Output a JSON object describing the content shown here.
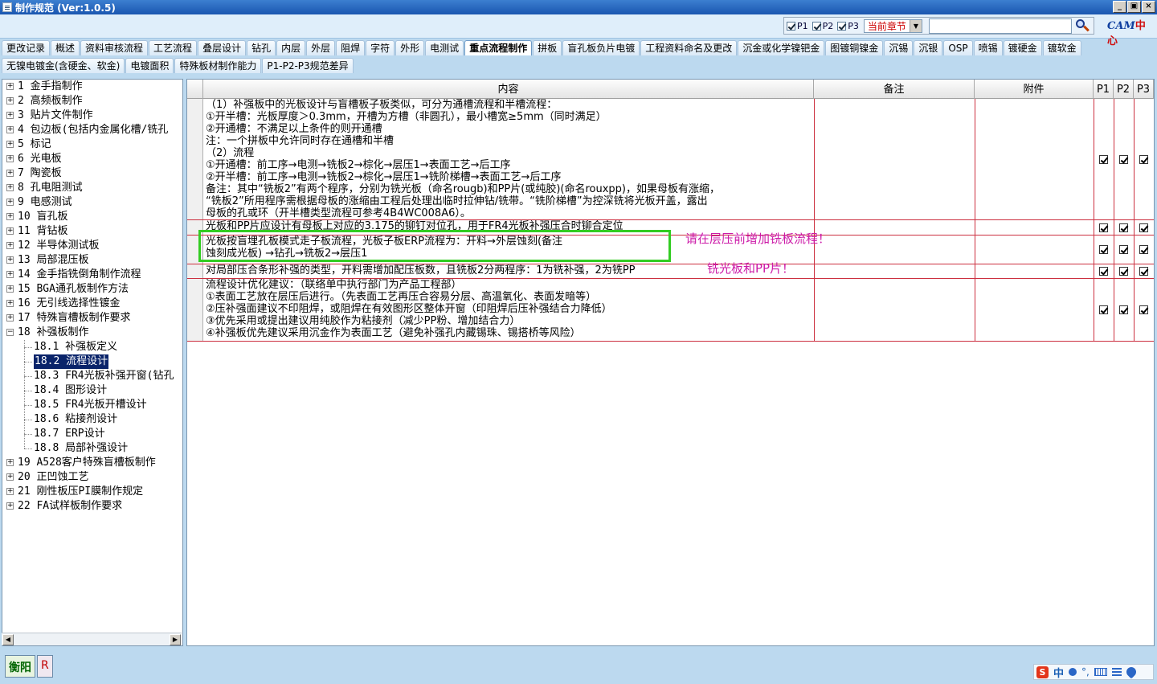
{
  "window": {
    "title": "制作规范 (Ver:1.0.5)",
    "buttons": [
      "_",
      "▣",
      "×"
    ]
  },
  "toolbar": {
    "filters": [
      {
        "label": "P1",
        "checked": true
      },
      {
        "label": "P2",
        "checked": true
      },
      {
        "label": "P3",
        "checked": true
      }
    ],
    "scope_value": "当前章节",
    "scope_arrow": "▼",
    "search_value": "",
    "logo_main": "CAM",
    "logo_accent": "中心"
  },
  "tabs": {
    "row1": [
      "更改记录",
      "概述",
      "资料审核流程",
      "工艺流程",
      "叠层设计",
      "钻孔",
      "内层",
      "外层",
      "阻焊",
      "字符",
      "外形",
      "电测试",
      "重点流程制作",
      "拼板",
      "盲孔板负片电镀",
      "工程资料命名及更改",
      "沉金或化学镍钯金",
      "图镀铜镍金",
      "沉锡",
      "沉银",
      "OSP",
      "喷锡",
      "镀硬金",
      "镀软金"
    ],
    "row2": [
      "无镍电镀金(含硬金、软金)",
      "电镀面积",
      "特殊板材制作能力",
      "P1-P2-P3规范差异"
    ],
    "active": "重点流程制作"
  },
  "tree": [
    {
      "label": "1  金手指制作",
      "expander": "+"
    },
    {
      "label": "2  高频板制作",
      "expander": "+"
    },
    {
      "label": "3  贴片文件制作",
      "expander": "+"
    },
    {
      "label": "4  包边板(包括内金属化槽/铣孔",
      "expander": "+"
    },
    {
      "label": "5  标记",
      "expander": "+"
    },
    {
      "label": "6  光电板",
      "expander": "+"
    },
    {
      "label": "7  陶瓷板",
      "expander": "+"
    },
    {
      "label": "8  孔电阻测试",
      "expander": "+"
    },
    {
      "label": "9  电感测试",
      "expander": "+"
    },
    {
      "label": "10  盲孔板",
      "expander": "+"
    },
    {
      "label": "11  背钻板",
      "expander": "+"
    },
    {
      "label": "12  半导体测试板",
      "expander": "+"
    },
    {
      "label": "13  局部混压板",
      "expander": "+"
    },
    {
      "label": "14  金手指铣倒角制作流程",
      "expander": "+"
    },
    {
      "label": "15  BGA通孔板制作方法",
      "expander": "+"
    },
    {
      "label": "16  无引线选择性镀金",
      "expander": "+"
    },
    {
      "label": "17  特殊盲槽板制作要求",
      "expander": "+"
    },
    {
      "label": "18  补强板制作",
      "expander": "−"
    },
    {
      "label": "18.1  补强板定义",
      "child": true
    },
    {
      "label": "18.2  流程设计",
      "child": true,
      "selected": true
    },
    {
      "label": "18.3  FR4光板补强开窗(钻孔",
      "child": true
    },
    {
      "label": "18.4  图形设计",
      "child": true
    },
    {
      "label": "18.5  FR4光板开槽设计",
      "child": true
    },
    {
      "label": "18.6  粘接剂设计",
      "child": true
    },
    {
      "label": "18.7  ERP设计",
      "child": true
    },
    {
      "label": "18.8  局部补强设计",
      "child": true
    },
    {
      "label": "19  A528客户特殊盲槽板制作",
      "expander": "+"
    },
    {
      "label": "20  正凹蚀工艺",
      "expander": "+"
    },
    {
      "label": "21  刚性板压PI膜制作规定",
      "expander": "+"
    },
    {
      "label": "22  FA试样板制作要求",
      "expander": "+"
    }
  ],
  "tree_scroll": {
    "left": "◀",
    "right": "▶"
  },
  "grid": {
    "headers": {
      "content": "内容",
      "note": "备注",
      "attach": "附件",
      "p1": "P1",
      "p2": "P2",
      "p3": "P3"
    },
    "rows": [
      {
        "text": "（1）补强板中的光板设计与盲槽板子板类似，可分为通槽流程和半槽流程：\n①开半槽：光板厚度＞0.3mm，开槽为方槽（非圆孔），最小槽宽≥5mm（同时满足）\n②开通槽：不满足以上条件的则开通槽\n注：一个拼板中允许同时存在通槽和半槽\n（2）流程\n①开通槽：前工序→电测→铣板2→棕化→层压1→表面工艺→后工序\n②开半槽：前工序→电测→铣板2→棕化→层压1→铣阶梯槽→表面工艺→后工序\n备注：其中“铣板2”有两个程序，分别为铣光板（命名rougb)和PP片(或纯胶)(命名rouxpp)，如果母板有涨缩，\n“铣板2”所用程序需根据母板的涨缩由工程后处理出临时拉伸钻/铣带。“铣阶梯槽”为控深铣将光板开盖，露出\n母板的孔或环（开半槽类型流程可参考4B4WC008A6）。",
        "p1": true,
        "p2": true,
        "p3": true
      },
      {
        "text": "光板和PP片应设计有母板上对应的3.175的铆钉对位孔，用于FR4光板补强压合时铆合定位",
        "p1": true,
        "p2": true,
        "p3": true
      },
      {
        "text": "光板按盲埋孔板模式走子板流程，光板子板ERP流程为：开料→外层蚀刻(备注\n蚀刻成光板) →钻孔→铣板2→层压1",
        "p1": true,
        "p2": true,
        "p3": true
      },
      {
        "text": "对局部压合条形补强的类型，开料需增加配压板数，且铣板2分两程序：1为铣补强，2为铣PP",
        "p1": true,
        "p2": true,
        "p3": true
      },
      {
        "text": "流程设计优化建议：（联络单中执行部门为产品工程部）\n①表面工艺放在层压后进行。（先表面工艺再压合容易分层、高温氧化、表面发暗等）\n②压补强面建议不印阻焊，或阻焊在有效图形区整体开窗（印阻焊后压补强结合力降低）\n③优先采用或提出建议用纯胶作为粘接剂（减少PP粉、增加结合力）\n④补强板优先建议采用沉金作为表面工艺（避免补强孔内藏锡珠、锡搭桥等风险）",
        "p1": true,
        "p2": true,
        "p3": true
      }
    ]
  },
  "annotations": {
    "line1": "请在层压前增加铣板流程！",
    "line2": "铣光板和PP片！"
  },
  "status": {
    "site": "衡阳",
    "flag": "R",
    "ime_logo": "S",
    "ime_lang": "中",
    "ime_punct": "°,"
  }
}
